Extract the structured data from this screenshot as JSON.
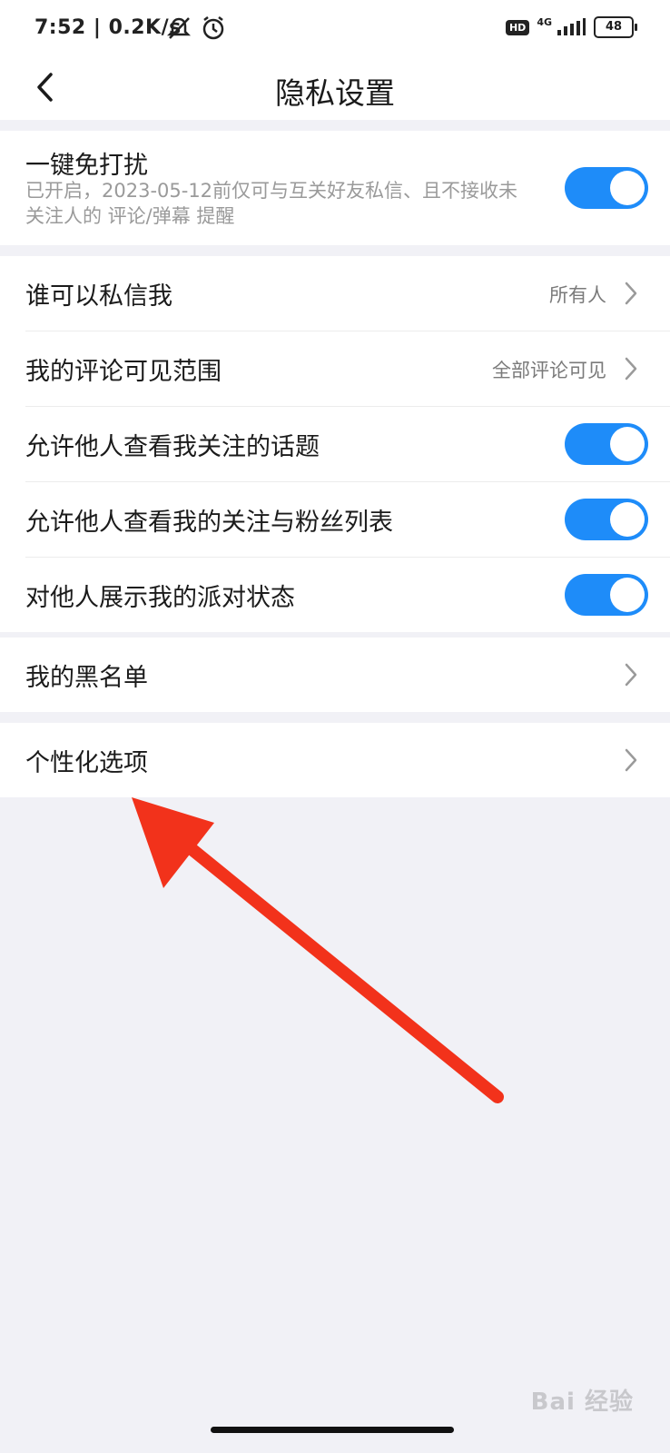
{
  "status": {
    "time_speed": "7:52 | 0.2K/s",
    "hd": "HD",
    "network": "4G",
    "battery": "48"
  },
  "header": {
    "title": "隐私设置"
  },
  "dnd": {
    "title": "一键免打扰",
    "description": "已开启，2023-05-12前仅可与互关好友私信、且不接收未关注人的 评论/弹幕 提醒",
    "enabled": true
  },
  "settings": [
    {
      "label": "谁可以私信我",
      "value": "所有人"
    },
    {
      "label": "我的评论可见范围",
      "value": "全部评论可见"
    },
    {
      "label": "允许他人查看我关注的话题",
      "enabled": true
    },
    {
      "label": "允许他人查看我的关注与粉丝列表",
      "enabled": true
    },
    {
      "label": "对他人展示我的派对状态",
      "enabled": true
    }
  ],
  "blacklist": {
    "label": "我的黑名单"
  },
  "personalization": {
    "label": "个性化选项"
  },
  "watermark": "Bai 经验",
  "colors": {
    "accent": "#1e8cf9",
    "annotation_arrow": "#f2321b",
    "background": "#f1f1f6"
  }
}
